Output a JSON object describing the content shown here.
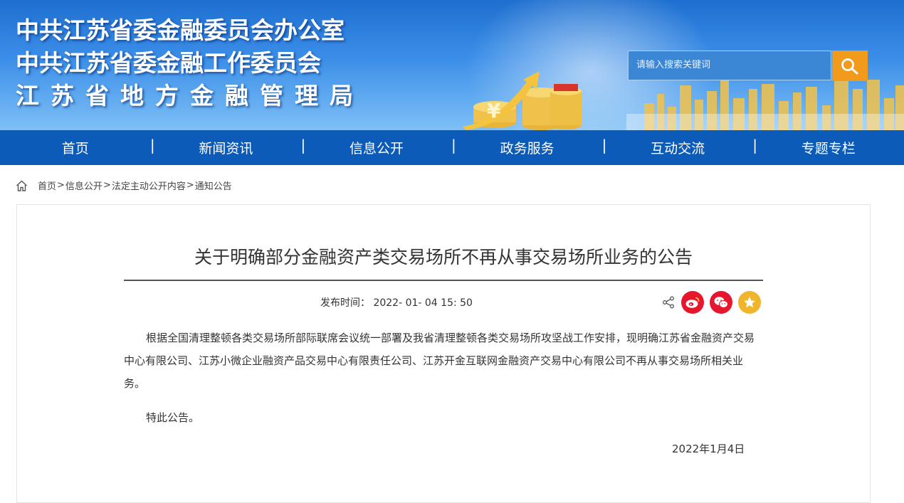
{
  "header": {
    "title_lines": [
      "中共江苏省委金融委员会办公室",
      "中共江苏省委金融工作委员会",
      "江苏省地方金融管理局"
    ],
    "search_placeholder": "请输入搜索关键词",
    "search_icon": "search-icon"
  },
  "nav": {
    "items": [
      {
        "label": "首页"
      },
      {
        "label": "新闻资讯"
      },
      {
        "label": "信息公开"
      },
      {
        "label": "政务服务"
      },
      {
        "label": "互动交流"
      },
      {
        "label": "专题专栏"
      }
    ],
    "separator": "|"
  },
  "breadcrumb": {
    "icon": "home-icon",
    "items": [
      "首页",
      "信息公开",
      "法定主动公开内容",
      "通知公告"
    ],
    "separator": ">"
  },
  "article": {
    "title": "关于明确部分金融资产类交易场所不再从事交易场所业务的公告",
    "publish_label": "发布时间：",
    "publish_time": "2022- 01- 04 15: 50",
    "paragraphs": [
      "根据全国清理整顿各类交易场所部际联席会议统一部署及我省清理整顿各类交易场所攻坚战工作安排，现明确江苏省金融资产交易中心有限公司、江苏小微企业融资产品交易中心有限责任公司、江苏开金互联网金融资产交易中心有限公司不再从事交易场所相关业务。",
      "特此公告。"
    ],
    "date_sign": "2022年1月4日"
  },
  "share": {
    "icons": [
      "share-icon",
      "weibo-icon",
      "wechat-icon",
      "favorite-icon"
    ]
  },
  "colors": {
    "nav_bg": "#0d5bb8",
    "search_button": "#f29a1c",
    "weibo_red": "#e6162d",
    "favorite_yellow": "#f0b52b"
  }
}
